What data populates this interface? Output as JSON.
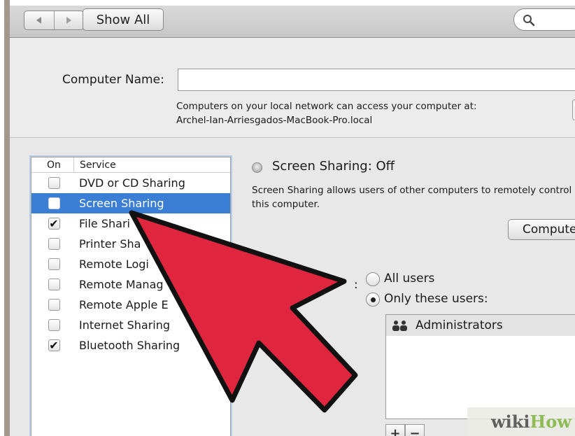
{
  "toolbar": {
    "back_icon": "back-arrow-icon",
    "forward_icon": "forward-arrow-icon",
    "show_all_label": "Show All",
    "search_icon": "search-icon"
  },
  "computer_name": {
    "label": "Computer Name:",
    "value": "",
    "info_line1": "Computers on your local network can access your computer at:",
    "info_line2": "Archel-Ian-Arriesgados-MacBook-Pro.local"
  },
  "service_list": {
    "header_on": "On",
    "header_service": "Service",
    "items": [
      {
        "label": "DVD or CD Sharing",
        "checked": false,
        "selected": false
      },
      {
        "label": "Screen Sharing",
        "checked": false,
        "selected": true
      },
      {
        "label": "File Shari",
        "checked": true,
        "selected": false
      },
      {
        "label": "Printer Sha",
        "checked": false,
        "selected": false
      },
      {
        "label": "Remote Logi",
        "checked": false,
        "selected": false
      },
      {
        "label": "Remote Manag",
        "checked": false,
        "selected": false
      },
      {
        "label": "Remote Apple E",
        "checked": false,
        "selected": false
      },
      {
        "label": "Internet Sharing",
        "checked": false,
        "selected": false
      },
      {
        "label": "Bluetooth Sharing",
        "checked": true,
        "selected": false
      }
    ]
  },
  "detail": {
    "status": "Screen Sharing: Off",
    "description": "Screen Sharing allows users of other computers to remotely control this computer.",
    "computer_settings_label": "Compute",
    "access_colon": ":",
    "all_users_label": "All users",
    "only_these_users_label": "Only these users:",
    "selected_access": "only_these_users",
    "users": [
      {
        "label": "Administrators",
        "icon": "group-icon"
      }
    ],
    "add_label": "+",
    "remove_label": "−"
  },
  "overlay": {
    "arrow_color": "#e0253f",
    "arrow_outline": "#111111"
  },
  "watermark": {
    "part1": "wiki",
    "part2": "How"
  },
  "colors": {
    "selection": "#3b7ed6",
    "window_bg": "#e8e8e8"
  }
}
